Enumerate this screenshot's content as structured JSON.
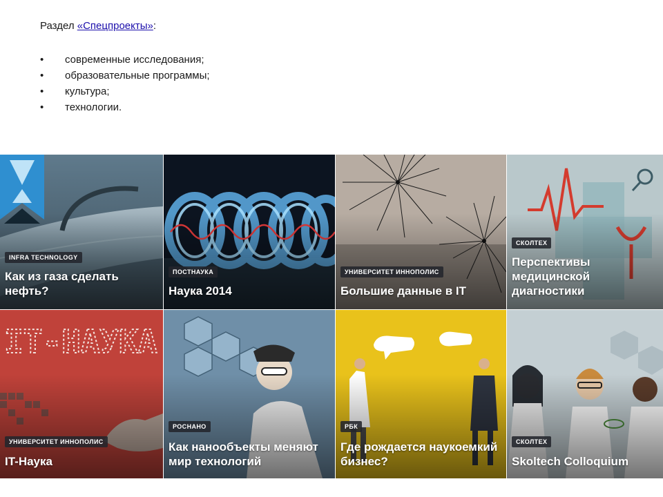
{
  "intro": {
    "prefix": "Раздел ",
    "link_text": "«Спецпроекты»",
    "suffix": ":"
  },
  "bullets": [
    "современные исследования;",
    "образовательные программы;",
    "культура;",
    "технологии."
  ],
  "tiles": [
    {
      "badge": "INFRA TECHNOLOGY",
      "title": "Как из газа сделать нефть?"
    },
    {
      "badge": "ПОСТНАУКА",
      "title": "Наука 2014"
    },
    {
      "badge": "УНИВЕРСИТЕТ ИННОПОЛИС",
      "title": "Большие данные в IT"
    },
    {
      "badge": "СКОЛТЕХ",
      "title": "Перспективы медицинской диагностики"
    },
    {
      "badge": "УНИВЕРСИТЕТ ИННОПОЛИС",
      "title": "IT-Наука",
      "art_text": "IT-НАУКА"
    },
    {
      "badge": "РОСНАНО",
      "title": "Как нанообъекты меняют мир технологий"
    },
    {
      "badge": "РБК",
      "title": "Где рождается наукоемкий бизнес?"
    },
    {
      "badge": "СКОЛТЕХ",
      "title": "Skoltech Colloquium"
    }
  ]
}
